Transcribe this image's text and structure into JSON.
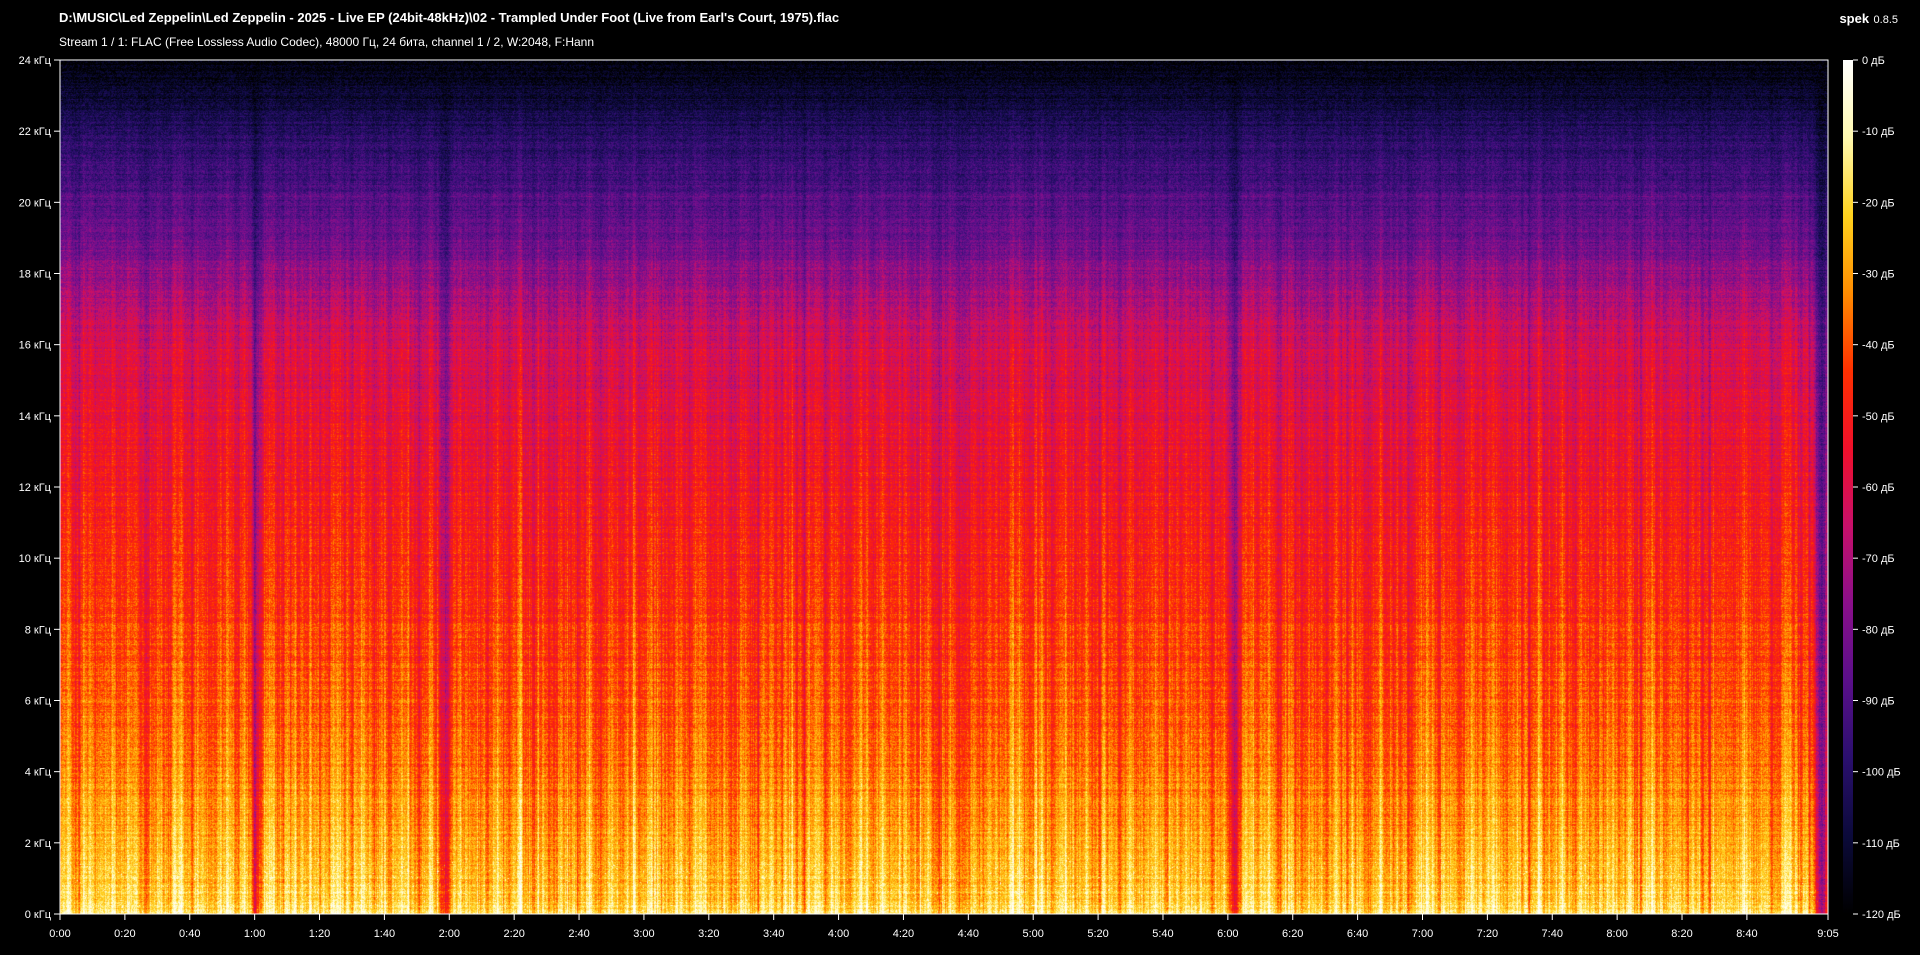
{
  "window": {
    "file_path": "D:\\MUSIC\\Led Zeppelin\\Led Zeppelin - 2025 - Live EP (24bit-48kHz)\\02 - Trampled Under Foot (Live from Earl's Court, 1975).flac",
    "stream_info": "Stream 1 / 1: FLAC (Free Lossless Audio Codec), 48000 Гц, 24 бита, channel 1 / 2, W:2048, F:Hann",
    "app_name": "spek",
    "app_version": "0.8.5"
  },
  "colors": {
    "background": "#000000",
    "text": "#ffffff",
    "palette": [
      "#000000",
      "#0b0a3a",
      "#2a0f6e",
      "#5a0f8a",
      "#8a0f8a",
      "#c8106a",
      "#f0102a",
      "#ff3000",
      "#ff8c00",
      "#ffd21e",
      "#fff9b0",
      "#ffffff"
    ]
  },
  "chart_data": {
    "type": "heatmap",
    "title": "",
    "xlabel": "",
    "ylabel": "",
    "x_unit": "time",
    "xlim": [
      "0:00",
      "9:05"
    ],
    "x_ticks": [
      "0:00",
      "0:20",
      "0:40",
      "1:00",
      "1:20",
      "1:40",
      "2:00",
      "2:20",
      "2:40",
      "3:00",
      "3:20",
      "3:40",
      "4:00",
      "4:20",
      "4:40",
      "5:00",
      "5:20",
      "5:40",
      "6:00",
      "6:20",
      "6:40",
      "7:00",
      "7:20",
      "7:40",
      "8:00",
      "8:20",
      "8:40",
      "9:05"
    ],
    "x_tick_seconds": [
      0,
      20,
      40,
      60,
      80,
      100,
      120,
      140,
      160,
      180,
      200,
      220,
      240,
      260,
      280,
      300,
      320,
      340,
      360,
      380,
      400,
      420,
      440,
      460,
      480,
      500,
      520,
      545
    ],
    "duration_seconds": 545,
    "ylim_khz": [
      0,
      24
    ],
    "y_ticks": [
      "0 кГц",
      "2 кГц",
      "4 кГц",
      "6 кГц",
      "8 кГц",
      "10 кГц",
      "12 кГц",
      "14 кГц",
      "16 кГц",
      "18 кГц",
      "20 кГц",
      "22 кГц",
      "24 кГц"
    ],
    "y_tick_khz": [
      0,
      2,
      4,
      6,
      8,
      10,
      12,
      14,
      16,
      18,
      20,
      22,
      24
    ],
    "colorbar": {
      "range_db": [
        -120,
        0
      ],
      "ticks": [
        "0 дБ",
        "-10 дБ",
        "-20 дБ",
        "-30 дБ",
        "-40 дБ",
        "-50 дБ",
        "-60 дБ",
        "-70 дБ",
        "-80 дБ",
        "-90 дБ",
        "-100 дБ",
        "-110 дБ",
        "-120 дБ"
      ],
      "tick_db": [
        0,
        -10,
        -20,
        -30,
        -40,
        -50,
        -60,
        -70,
        -80,
        -90,
        -100,
        -110,
        -120
      ]
    },
    "features": {
      "energy_cutoff_khz": 22,
      "faint_line_khz": 20.2,
      "quiet_moments_seconds": [
        60,
        119,
        362,
        543
      ]
    }
  }
}
